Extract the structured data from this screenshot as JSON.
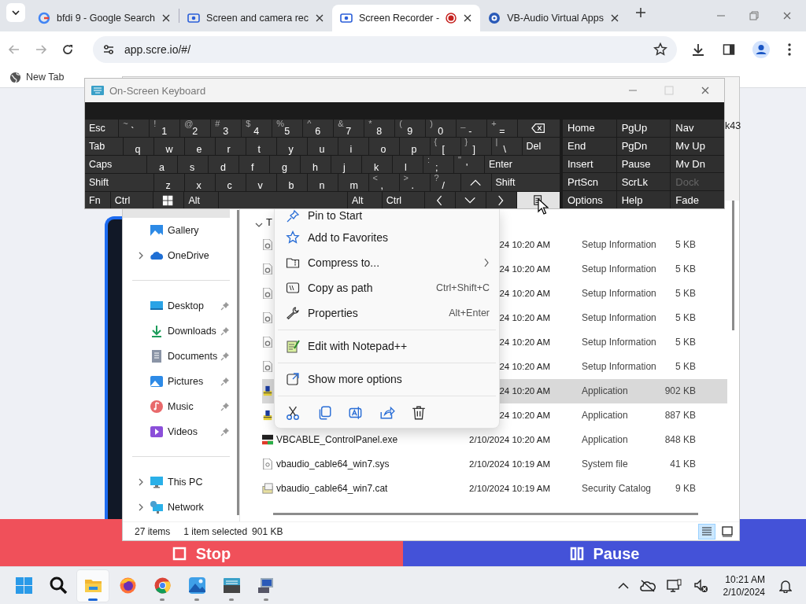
{
  "browser": {
    "tabs": [
      {
        "kind": "google",
        "title": "bfdi 9 - Google Search",
        "selected": false,
        "recording": false
      },
      {
        "kind": "recorder",
        "title": "Screen and camera rec",
        "selected": false,
        "recording": false
      },
      {
        "kind": "recorder",
        "title": "Screen Recorder -",
        "selected": true,
        "recording": true
      },
      {
        "kind": "vb",
        "title": "VB-Audio Virtual Apps",
        "selected": false,
        "recording": false
      }
    ],
    "address": "app.scre.io/#/",
    "bookmarks": [
      "New Tab"
    ]
  },
  "page": {
    "buttons": [
      {
        "kind": "stop",
        "label": "Stop"
      },
      {
        "kind": "pause",
        "label": "Pause"
      }
    ]
  },
  "explorer": {
    "partial_text": "k43",
    "nav": [
      {
        "kind": "gallery",
        "label": "Gallery",
        "expandable": false,
        "pinned": false
      },
      {
        "kind": "onedrive",
        "label": "OneDrive",
        "expandable": true,
        "pinned": false
      },
      {
        "kind": "separator"
      },
      {
        "kind": "desktop",
        "label": "Desktop",
        "expandable": false,
        "pinned": true
      },
      {
        "kind": "downloads",
        "label": "Downloads",
        "expandable": false,
        "pinned": true
      },
      {
        "kind": "documents",
        "label": "Documents",
        "expandable": false,
        "pinned": true
      },
      {
        "kind": "pictures",
        "label": "Pictures",
        "expandable": false,
        "pinned": true
      },
      {
        "kind": "music",
        "label": "Music",
        "expandable": false,
        "pinned": true
      },
      {
        "kind": "videos",
        "label": "Videos",
        "expandable": false,
        "pinned": true
      },
      {
        "kind": "separator"
      },
      {
        "kind": "pc",
        "label": "This PC",
        "expandable": true,
        "pinned": false
      },
      {
        "kind": "network",
        "label": "Network",
        "expandable": true,
        "pinned": false
      }
    ],
    "group_header": "T",
    "files": [
      {
        "kind": "setup",
        "date": "24 10:20 AM",
        "type": "Setup Information",
        "size": "5 KB",
        "selected": false
      },
      {
        "kind": "setup",
        "date": "24 10:20 AM",
        "type": "Setup Information",
        "size": "5 KB",
        "selected": false
      },
      {
        "kind": "setup",
        "date": "24 10:20 AM",
        "type": "Setup Information",
        "size": "5 KB",
        "selected": false
      },
      {
        "kind": "setup",
        "date": "24 10:20 AM",
        "type": "Setup Information",
        "size": "5 KB",
        "selected": false
      },
      {
        "kind": "setup",
        "date": "24 10:20 AM",
        "type": "Setup Information",
        "size": "5 KB",
        "selected": false
      },
      {
        "kind": "setup",
        "date": "24 10:20 AM",
        "type": "Setup Information",
        "size": "5 KB",
        "selected": false
      },
      {
        "kind": "installer",
        "date": "24 10:20 AM",
        "type": "Application",
        "size": "902 KB",
        "selected": true
      },
      {
        "kind": "installer",
        "date": "24 10:20 AM",
        "type": "Application",
        "size": "887 KB",
        "selected": false
      },
      {
        "kind": "vb",
        "name": "VBCABLE_ControlPanel.exe",
        "date": "2/10/2024 10:20 AM",
        "type": "Application",
        "size": "848 KB",
        "selected": false
      },
      {
        "kind": "sys",
        "name": "vbaudio_cable64_win7.sys",
        "date": "2/10/2024 10:19 AM",
        "type": "System file",
        "size": "41 KB",
        "selected": false
      },
      {
        "kind": "cat",
        "name": "vbaudio_cable64_win7.cat",
        "date": "2/10/2024 10:19 AM",
        "type": "Security Catalog",
        "size": "9 KB",
        "selected": false
      }
    ],
    "status": {
      "count": "27 items",
      "selection": "1 item selected",
      "size": "901 KB"
    },
    "views": [
      {
        "kind": "details",
        "selected": true
      },
      {
        "kind": "tiles",
        "selected": false
      }
    ]
  },
  "context_menu": {
    "items": [
      {
        "kind": "pin",
        "label": "Pin to Start",
        "submenu": false
      },
      {
        "kind": "star",
        "label": "Add to Favorites",
        "submenu": false
      },
      {
        "kind": "zip",
        "label": "Compress to...",
        "submenu": true
      },
      {
        "kind": "path",
        "label": "Copy as path",
        "shortcut": "Ctrl+Shift+C",
        "submenu": false
      },
      {
        "kind": "wrench",
        "label": "Properties",
        "shortcut": "Alt+Enter",
        "submenu": false
      },
      {
        "kind": "separator"
      },
      {
        "kind": "notepad",
        "label": "Edit with Notepad++",
        "submenu": false
      },
      {
        "kind": "separator"
      },
      {
        "kind": "more",
        "label": "Show more options",
        "submenu": false
      },
      {
        "kind": "separator"
      }
    ]
  },
  "keyboard": {
    "title": "On-Screen Keyboard",
    "rows": [
      [
        {
          "kind": "label",
          "label": "Esc"
        },
        {
          "kind": "char",
          "top": "~",
          "main": "`"
        },
        {
          "kind": "char",
          "top": "!",
          "main": "1"
        },
        {
          "kind": "char",
          "top": "@",
          "main": "2"
        },
        {
          "kind": "char",
          "top": "#",
          "main": "3"
        },
        {
          "kind": "char",
          "top": "$",
          "main": "4"
        },
        {
          "kind": "char",
          "top": "%",
          "main": "5"
        },
        {
          "kind": "char",
          "top": "^",
          "main": "6"
        },
        {
          "kind": "char",
          "top": "&",
          "main": "7"
        },
        {
          "kind": "char",
          "top": "*",
          "main": "8"
        },
        {
          "kind": "char",
          "top": "(",
          "main": "9"
        },
        {
          "kind": "char",
          "top": ")",
          "main": "0"
        },
        {
          "kind": "char",
          "top": "_",
          "main": "-"
        },
        {
          "kind": "char",
          "top": "+",
          "main": "="
        },
        {
          "kind": "backspace"
        }
      ],
      [
        {
          "kind": "label",
          "label": "Tab"
        },
        {
          "kind": "char",
          "main": "q"
        },
        {
          "kind": "char",
          "main": "w"
        },
        {
          "kind": "char",
          "main": "e"
        },
        {
          "kind": "char",
          "main": "r"
        },
        {
          "kind": "char",
          "main": "t"
        },
        {
          "kind": "char",
          "main": "y"
        },
        {
          "kind": "char",
          "main": "u"
        },
        {
          "kind": "char",
          "main": "i"
        },
        {
          "kind": "char",
          "main": "o"
        },
        {
          "kind": "char",
          "main": "p"
        },
        {
          "kind": "char",
          "top": "{",
          "main": "["
        },
        {
          "kind": "char",
          "top": "}",
          "main": "]"
        },
        {
          "kind": "char",
          "top": "|",
          "main": "\\"
        },
        {
          "kind": "label",
          "label": "Del"
        }
      ],
      [
        {
          "kind": "label",
          "label": "Caps"
        },
        {
          "kind": "char",
          "main": "a"
        },
        {
          "kind": "char",
          "main": "s"
        },
        {
          "kind": "char",
          "main": "d"
        },
        {
          "kind": "char",
          "main": "f"
        },
        {
          "kind": "char",
          "main": "g"
        },
        {
          "kind": "char",
          "main": "h"
        },
        {
          "kind": "char",
          "main": "j"
        },
        {
          "kind": "char",
          "main": "k"
        },
        {
          "kind": "char",
          "main": "l"
        },
        {
          "kind": "char",
          "top": ":",
          "main": ";"
        },
        {
          "kind": "char",
          "top": "\"",
          "main": "'"
        },
        {
          "kind": "label",
          "label": "Enter"
        }
      ],
      [
        {
          "kind": "label",
          "label": "Shift"
        },
        {
          "kind": "char",
          "main": "z"
        },
        {
          "kind": "char",
          "main": "x"
        },
        {
          "kind": "char",
          "main": "c"
        },
        {
          "kind": "char",
          "main": "v"
        },
        {
          "kind": "char",
          "main": "b"
        },
        {
          "kind": "char",
          "main": "n"
        },
        {
          "kind": "char",
          "main": "m"
        },
        {
          "kind": "char",
          "top": "<",
          "main": ","
        },
        {
          "kind": "char",
          "top": ">",
          "main": "."
        },
        {
          "kind": "char",
          "top": "?",
          "main": "/"
        },
        {
          "kind": "up"
        },
        {
          "kind": "label",
          "label": "Shift"
        }
      ],
      [
        {
          "kind": "label",
          "label": "Fn",
          "pressed": false
        },
        {
          "kind": "label",
          "label": "Ctrl",
          "pressed": false
        },
        {
          "kind": "windows",
          "pressed": false
        },
        {
          "kind": "label",
          "label": "Alt",
          "pressed": false
        },
        {
          "kind": "space",
          "pressed": false
        },
        {
          "kind": "label",
          "label": "Alt",
          "pressed": false
        },
        {
          "kind": "label",
          "label": "Ctrl",
          "pressed": false
        },
        {
          "kind": "left",
          "pressed": false
        },
        {
          "kind": "down",
          "pressed": false
        },
        {
          "kind": "right",
          "pressed": false
        },
        {
          "kind": "menu",
          "pressed": true
        }
      ]
    ],
    "side_keys": [
      {
        "label": "Home",
        "disabled": false
      },
      {
        "label": "PgUp",
        "disabled": false
      },
      {
        "label": "Nav",
        "disabled": false
      },
      {
        "label": "End",
        "disabled": false
      },
      {
        "label": "PgDn",
        "disabled": false
      },
      {
        "label": "Mv Up",
        "disabled": false
      },
      {
        "label": "Insert",
        "disabled": false
      },
      {
        "label": "Pause",
        "disabled": false
      },
      {
        "label": "Mv Dn",
        "disabled": false
      },
      {
        "label": "PrtScn",
        "disabled": false
      },
      {
        "label": "ScrLk",
        "disabled": false
      },
      {
        "label": "Dock",
        "disabled": true
      },
      {
        "label": "Options",
        "disabled": false
      },
      {
        "label": "Help",
        "disabled": false
      },
      {
        "label": "Fade",
        "disabled": false
      }
    ]
  },
  "taskbar": {
    "apps": [
      {
        "kind": "start",
        "selected": false,
        "running": false
      },
      {
        "kind": "search",
        "selected": false,
        "running": false
      },
      {
        "kind": "explorer",
        "selected": true,
        "running": true
      },
      {
        "kind": "firefox",
        "selected": false,
        "running": false
      },
      {
        "kind": "chrome",
        "selected": false,
        "running": true
      },
      {
        "kind": "photos",
        "selected": false,
        "running": true
      },
      {
        "kind": "osk",
        "selected": false,
        "running": true
      },
      {
        "kind": "remote",
        "selected": false,
        "running": true
      }
    ],
    "time": "10:21 AM",
    "date": "2/10/2024"
  }
}
